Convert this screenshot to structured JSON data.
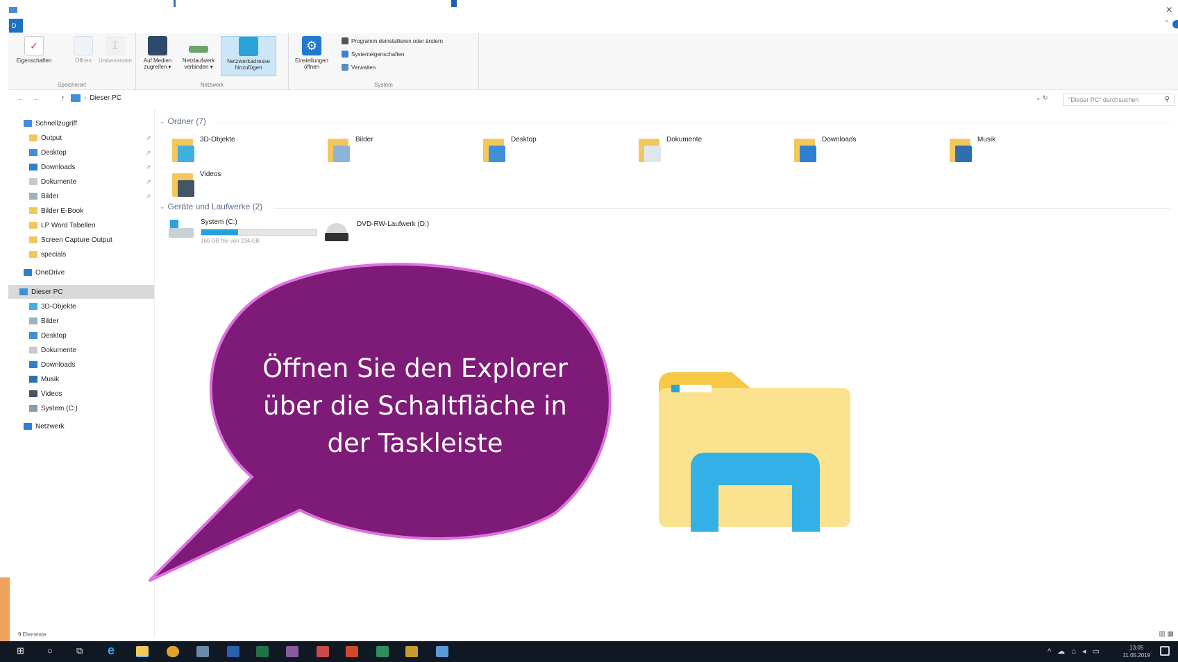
{
  "window": {
    "tab_label": "D",
    "close_glyph": "×",
    "minimize_glyph": "^"
  },
  "ribbon": {
    "groups": [
      {
        "label": "Speicherort",
        "buttons": [
          "Eigenschaften",
          "Öffnen",
          "Umbenennen"
        ]
      },
      {
        "label": "Netzwerk",
        "buttons": [
          "Auf Medien zugreifen ▾",
          "Netzlaufwerk verbinden ▾",
          "Netzwerkadresse hinzufügen"
        ]
      },
      {
        "label": "System",
        "buttons": [
          "Einstellungen öffnen"
        ],
        "small": [
          "Programm deinstallieren oder ändern",
          "Systemeigenschaften",
          "Verwalten"
        ]
      }
    ]
  },
  "address": {
    "back": "←",
    "forward": "→",
    "up": "↑",
    "crumb": "Dieser PC",
    "search_placeholder": "\"Dieser PC\" durchsuchen"
  },
  "sidebar": {
    "items": [
      {
        "label": "Schnellzugriff",
        "icon": "star-icon",
        "color": "#3f8fd9"
      },
      {
        "label": "Output",
        "icon": "folder-icon",
        "color": "#f2c75c",
        "pinned": true
      },
      {
        "label": "Desktop",
        "icon": "desktop-icon",
        "color": "#3f8fd9",
        "pinned": true
      },
      {
        "label": "Downloads",
        "icon": "download-icon",
        "color": "#2f7fd0",
        "pinned": true
      },
      {
        "label": "Dokumente",
        "icon": "document-icon",
        "color": "#c9c9c9",
        "pinned": true
      },
      {
        "label": "Bilder",
        "icon": "pictures-icon",
        "color": "#9fb0c0",
        "pinned": true
      },
      {
        "label": "Bilder E-Book",
        "icon": "folder-icon",
        "color": "#f2c75c"
      },
      {
        "label": "LP Word Tabellen",
        "icon": "folder-icon",
        "color": "#f2c75c"
      },
      {
        "label": "Screen Capture Output",
        "icon": "folder-icon",
        "color": "#f2c75c"
      },
      {
        "label": "specials",
        "icon": "folder-icon",
        "color": "#f2c75c"
      },
      {
        "label": "OneDrive",
        "icon": "cloud-icon",
        "color": "#2f7fd0"
      },
      {
        "label": "Dieser PC",
        "icon": "pc-icon",
        "color": "#3f8fd9",
        "selected": true
      },
      {
        "label": "3D-Objekte",
        "icon": "cube-icon",
        "color": "#3fb0e0"
      },
      {
        "label": "Bilder",
        "icon": "pictures-icon",
        "color": "#9fb0c0"
      },
      {
        "label": "Desktop",
        "icon": "desktop-icon",
        "color": "#3f8fd9"
      },
      {
        "label": "Dokumente",
        "icon": "document-icon",
        "color": "#c9c9c9"
      },
      {
        "label": "Downloads",
        "icon": "download-icon",
        "color": "#2f7fd0"
      },
      {
        "label": "Musik",
        "icon": "music-icon",
        "color": "#2f6fb0"
      },
      {
        "label": "Videos",
        "icon": "video-icon",
        "color": "#445566"
      },
      {
        "label": "System (C:)",
        "icon": "drive-icon",
        "color": "#8a9aaa"
      },
      {
        "label": "Netzwerk",
        "icon": "network-icon",
        "color": "#2f7fd0"
      }
    ],
    "pin_glyph": "⇗"
  },
  "main": {
    "folders_header": "Ordner (7)",
    "folders": [
      {
        "label": "3D-Objekte",
        "accent": "#3fb0e0"
      },
      {
        "label": "Bilder",
        "accent": "#8fb3d6"
      },
      {
        "label": "Desktop",
        "accent": "#3f8fd9"
      },
      {
        "label": "Dokumente",
        "accent": "#dfe6ee"
      },
      {
        "label": "Downloads",
        "accent": "#2f7fd0"
      },
      {
        "label": "Musik",
        "accent": "#2f6fb0"
      },
      {
        "label": "Videos",
        "accent": "#445566"
      }
    ],
    "drives_header": "Geräte und Laufwerke (2)",
    "drives": [
      {
        "label": "System (C:)",
        "sub": "160 GB frei von 234 GB",
        "used_fraction": 0.32
      },
      {
        "label": "DVD-RW-Laufwerk (D:)"
      }
    ]
  },
  "callout": {
    "text_line1": "Öffnen Sie den Explorer",
    "text_line2": "über die Schaltfläche in",
    "text_line3": "der Taskleiste",
    "fill": "#7e1a78",
    "stroke": "#e070e0"
  },
  "statusbar": {
    "text": "9 Elemente",
    "view_glyphs": "▥ ▦"
  },
  "taskbar": {
    "start_glyph": "⊞",
    "search_glyph": "○",
    "taskview_glyph": "⧉",
    "tray_glyphs": "^ ☁ ⌂ ◂ ▭",
    "time": "13:05",
    "date": "11.05.2019"
  }
}
